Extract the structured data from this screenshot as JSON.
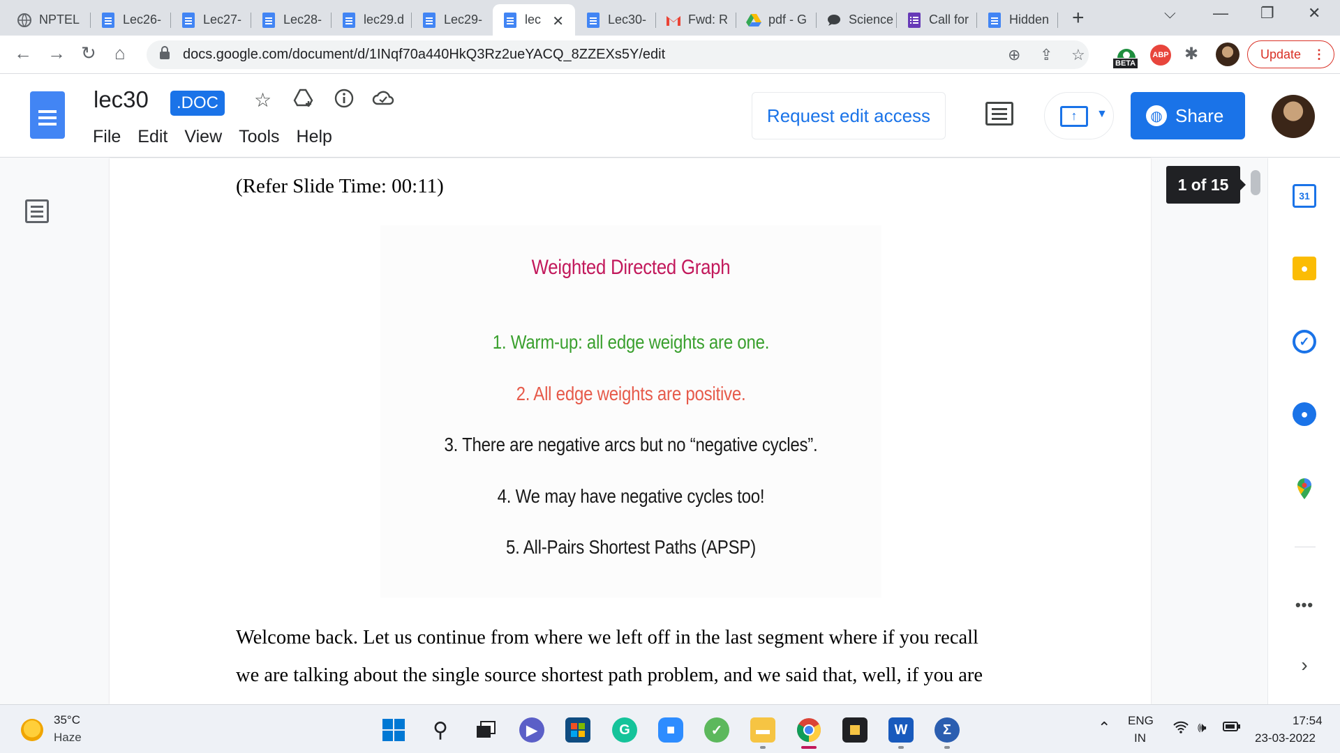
{
  "browser": {
    "tabs": [
      {
        "label": "NPTEL",
        "icon": "globe-icon"
      },
      {
        "label": "Lec26-",
        "icon": "docs-icon"
      },
      {
        "label": "Lec27-",
        "icon": "docs-icon"
      },
      {
        "label": "Lec28-",
        "icon": "docs-icon"
      },
      {
        "label": "lec29.d",
        "icon": "docs-icon"
      },
      {
        "label": "Lec29-",
        "icon": "docs-icon"
      },
      {
        "label": "lec",
        "icon": "docs-icon",
        "active": true
      },
      {
        "label": "Lec30-",
        "icon": "docs-icon"
      },
      {
        "label": "Fwd: R",
        "icon": "gmail-icon"
      },
      {
        "label": "pdf - G",
        "icon": "drive-icon"
      },
      {
        "label": "Science",
        "icon": "chat-icon"
      },
      {
        "label": "Call for",
        "icon": "forms-icon"
      },
      {
        "label": "Hidden",
        "icon": "docs-icon"
      }
    ],
    "new_tab_glyph": "+",
    "url": "docs.google.com/document/d/1INqf70a440HkQ3Rz2ueYACQ_8ZZEXs5Y/edit",
    "beta_badge": "BETA",
    "abp_badge": "ABP",
    "update_label": "Update"
  },
  "docs": {
    "title": "lec30",
    "file_type": ".DOC",
    "menu": [
      "File",
      "Edit",
      "View",
      "Tools",
      "Help"
    ],
    "request_access_label": "Request edit access",
    "share_label": "Share",
    "page_counter": "1 of 15"
  },
  "document": {
    "refer_slide": "(Refer Slide Time: 00:11)",
    "slide": {
      "title": "Weighted Directed Graph",
      "items": [
        "1. Warm-up: all edge weights are one.",
        "2. All edge weights are positive.",
        "3. There are negative arcs but no “negative cycles”.",
        "4. We may have negative cycles too!",
        "5. All-Pairs Shortest Paths (APSP)"
      ],
      "colors": {
        "title": "#c2185b",
        "item1": "#3aa02e",
        "item2": "#e65a4a",
        "rest": "#1a1a1a"
      }
    },
    "body": [
      "Welcome back. Let us continue from where we left off in the last segment where if you recall",
      "we are talking about the single source shortest path problem, and we said that, well, if you are"
    ]
  },
  "side_panel": {
    "calendar_day": "31"
  },
  "taskbar": {
    "temperature": "35°C",
    "condition": "Haze",
    "lang_1": "ENG",
    "lang_2": "IN",
    "time": "17:54",
    "date": "23-03-2022"
  },
  "colors": {
    "accent": "#1a73e8",
    "update_red": "#d93025"
  }
}
